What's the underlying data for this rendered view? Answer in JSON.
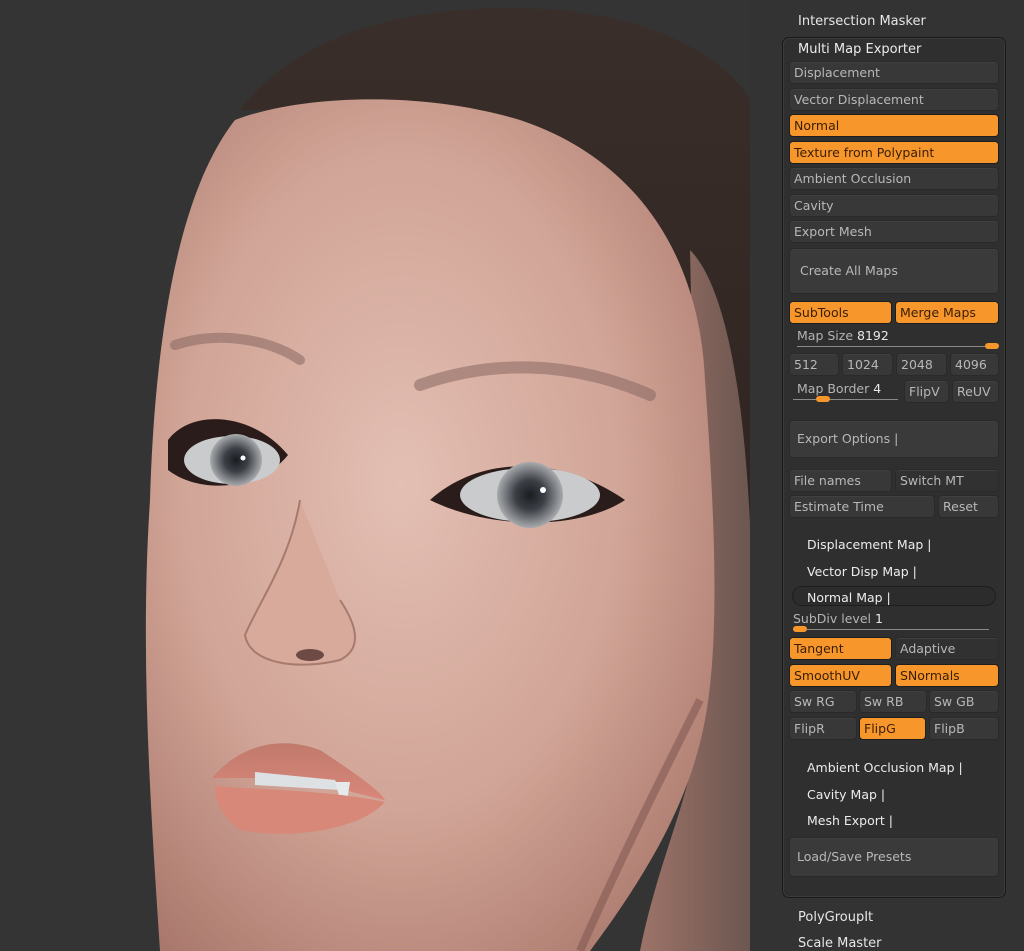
{
  "viewport": {
    "subject": "3D sculpted female head with fangs, skin texture render"
  },
  "panel": {
    "above_items": [
      "Intersection Masker"
    ],
    "below_items": [
      "PolyGroupIt",
      "Scale Master"
    ],
    "multi_map_exporter": {
      "title": "Multi Map Exporter",
      "map_toggles": [
        {
          "label": "Displacement",
          "on": false
        },
        {
          "label": "Vector Displacement",
          "on": false
        },
        {
          "label": "Normal",
          "on": true
        },
        {
          "label": "Texture from Polypaint",
          "on": true
        },
        {
          "label": "Ambient Occlusion",
          "on": false
        },
        {
          "label": "Cavity",
          "on": false
        },
        {
          "label": "Export Mesh",
          "on": false
        }
      ],
      "create_all_maps": "Create All Maps",
      "subtools": {
        "label": "SubTools",
        "on": true
      },
      "merge_maps": {
        "label": "Merge Maps",
        "on": true
      },
      "map_size": {
        "label": "Map Size",
        "value": "8192",
        "fraction": 1.0
      },
      "size_presets": [
        "512",
        "1024",
        "2048",
        "4096"
      ],
      "map_border": {
        "label": "Map Border",
        "value": "4",
        "fraction": 0.25
      },
      "flipv": "FlipV",
      "reuv": "ReUV",
      "export_options": "Export Options |",
      "file_names": "File names",
      "switch_mt": "Switch MT",
      "estimate_time": "Estimate Time",
      "reset": "Reset",
      "sub_sections": {
        "displacement_map": "Displacement Map |",
        "vector_disp_map": "Vector Disp Map |",
        "normal_map": "Normal Map |",
        "ambient_occlusion_map": "Ambient Occlusion Map |",
        "cavity_map": "Cavity Map |",
        "mesh_export": "Mesh Export |"
      },
      "subdiv_level": {
        "label": "SubDiv level",
        "value": "1",
        "fraction": 0.0
      },
      "tangent": {
        "label": "Tangent",
        "on": true
      },
      "adaptive": {
        "label": "Adaptive",
        "on": false
      },
      "smoothuv": {
        "label": "SmoothUV",
        "on": true
      },
      "snormals": {
        "label": "SNormals",
        "on": true
      },
      "swaps": [
        {
          "label": "Sw RG",
          "on": false
        },
        {
          "label": "Sw RB",
          "on": false
        },
        {
          "label": "Sw GB",
          "on": false
        }
      ],
      "flips": [
        {
          "label": "FlipR",
          "on": false
        },
        {
          "label": "FlipG",
          "on": true
        },
        {
          "label": "FlipB",
          "on": false
        }
      ],
      "load_save_presets": "Load/Save Presets"
    }
  },
  "colors": {
    "accent_orange": "#f7962b",
    "panel_bg": "#333333",
    "button_bg": "#383838"
  }
}
